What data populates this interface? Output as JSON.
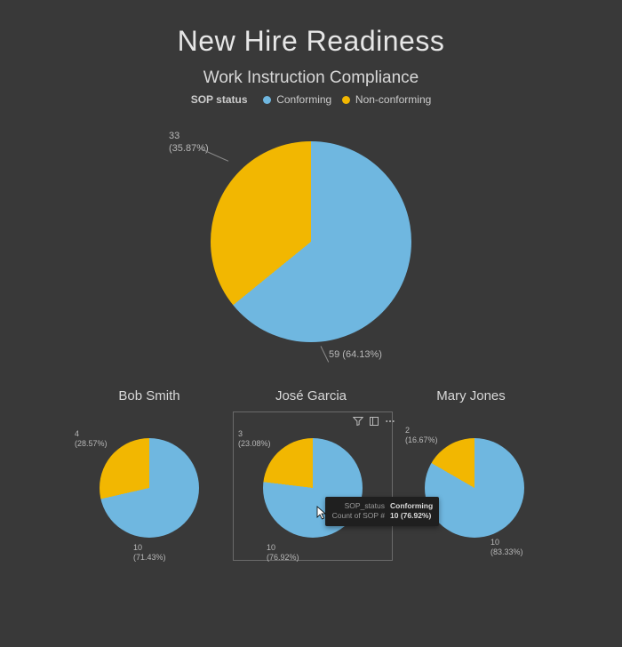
{
  "title": "New Hire Readiness",
  "subtitle": "Work Instruction Compliance",
  "legend": {
    "label": "SOP status",
    "items": [
      {
        "name": "Conforming",
        "color": "#6fb7e0"
      },
      {
        "name": "Non-conforming",
        "color": "#f2b701"
      }
    ]
  },
  "colors": {
    "conforming": "#6fb7e0",
    "nonconforming": "#f2b701"
  },
  "main_chart": {
    "conforming": {
      "count": 59,
      "pct": 64.13,
      "label": "59 (64.13%)"
    },
    "nonconforming": {
      "count": 33,
      "pct": 35.87,
      "label_count": "33",
      "label_pct": "(35.87%)"
    }
  },
  "people": [
    {
      "name": "Bob Smith",
      "conforming": {
        "count": 10,
        "pct": 71.43,
        "label_count": "10",
        "label_pct": "(71.43%)"
      },
      "nonconforming": {
        "count": 4,
        "pct": 28.57,
        "label_count": "4",
        "label_pct": "(28.57%)"
      }
    },
    {
      "name": "José Garcia",
      "conforming": {
        "count": 10,
        "pct": 76.92,
        "label_count": "10",
        "label_pct": "(76.92%)"
      },
      "nonconforming": {
        "count": 3,
        "pct": 23.08,
        "label_count": "3",
        "label_pct": "(23.08%)"
      }
    },
    {
      "name": "Mary Jones",
      "conforming": {
        "count": 10,
        "pct": 83.33,
        "label_count": "10",
        "label_pct": "(83.33%)"
      },
      "nonconforming": {
        "count": 2,
        "pct": 16.67,
        "label_count": "2",
        "label_pct": "(16.67%)"
      }
    }
  ],
  "tooltip": {
    "rows": [
      {
        "k": "SOP_status",
        "v": "Conforming"
      },
      {
        "k": "Count of SOP #",
        "v": "10 (76.92%)"
      }
    ]
  },
  "chart_data": [
    {
      "type": "pie",
      "title": "Work Instruction Compliance",
      "series_name": "SOP status",
      "categories": [
        "Conforming",
        "Non-conforming"
      ],
      "values": [
        59,
        33
      ],
      "percentages": [
        64.13,
        35.87
      ]
    },
    {
      "type": "pie",
      "title": "Bob Smith",
      "categories": [
        "Conforming",
        "Non-conforming"
      ],
      "values": [
        10,
        4
      ],
      "percentages": [
        71.43,
        28.57
      ]
    },
    {
      "type": "pie",
      "title": "José Garcia",
      "categories": [
        "Conforming",
        "Non-conforming"
      ],
      "values": [
        10,
        3
      ],
      "percentages": [
        76.92,
        23.08
      ]
    },
    {
      "type": "pie",
      "title": "Mary Jones",
      "categories": [
        "Conforming",
        "Non-conforming"
      ],
      "values": [
        10,
        2
      ],
      "percentages": [
        83.33,
        16.67
      ]
    }
  ]
}
